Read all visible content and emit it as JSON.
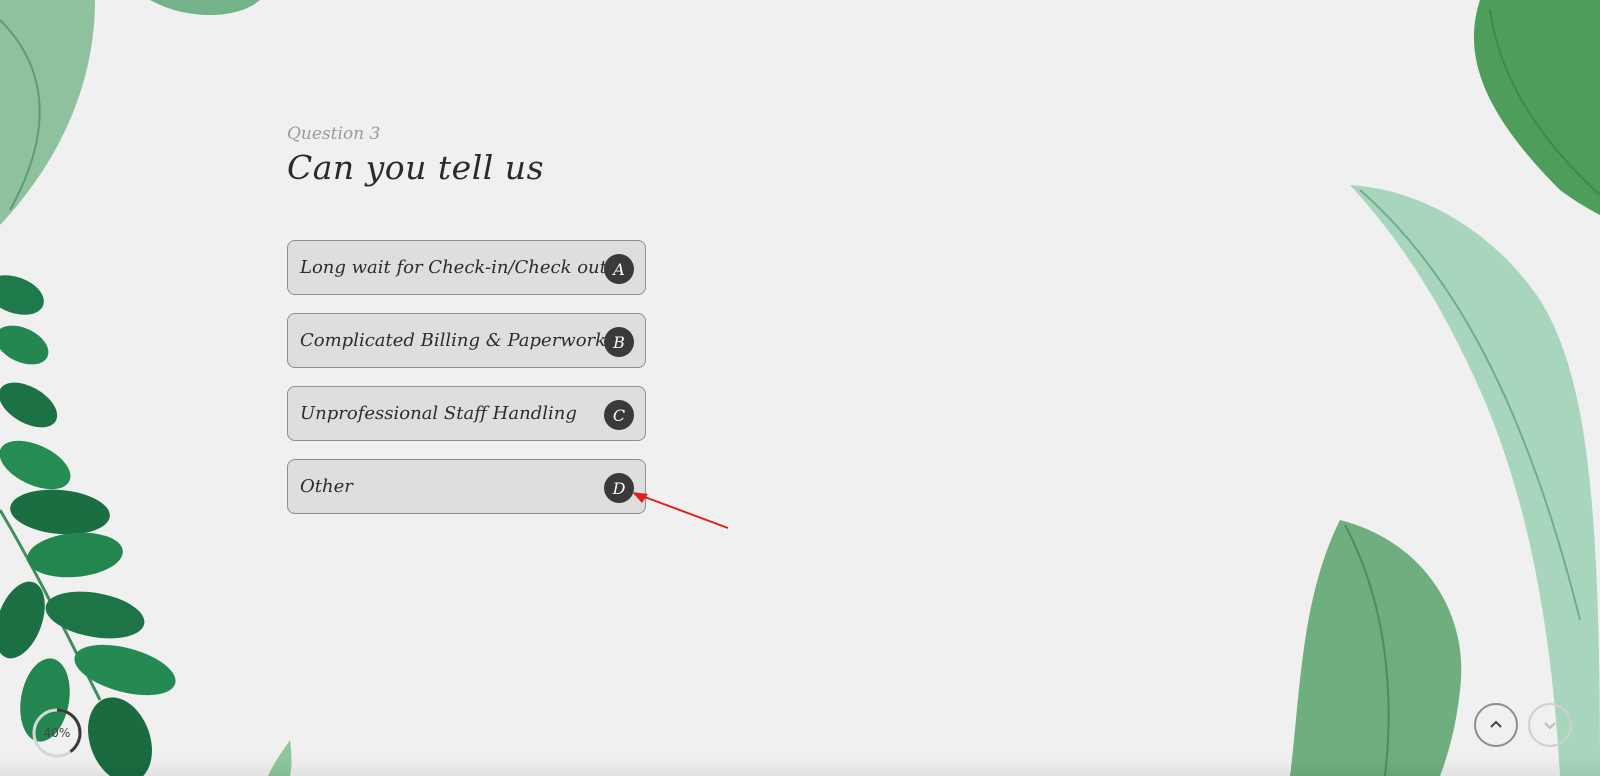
{
  "question": {
    "number_label": "Question 3",
    "title": "Can you tell us"
  },
  "options": [
    {
      "label": "Long wait for Check-in/Check out",
      "key": "A"
    },
    {
      "label": "Complicated Billing & Paperwork",
      "key": "B"
    },
    {
      "label": "Unprofessional Staff Handling",
      "key": "C"
    },
    {
      "label": "Other",
      "key": "D"
    }
  ],
  "progress": {
    "percent_text": "40%",
    "fraction": 0.4
  },
  "navigation": {
    "up_icon": "chevron-up-icon",
    "down_icon": "chevron-down-icon"
  },
  "colors": {
    "background": "#f0f0f0",
    "option_fill": "#dedede",
    "option_border": "#8e8e8e",
    "key_badge": "#3a3a3a",
    "annotation_arrow": "#e0201c",
    "leaf_dark": "#1e7a4a",
    "leaf_light": "#8cc9a6"
  }
}
